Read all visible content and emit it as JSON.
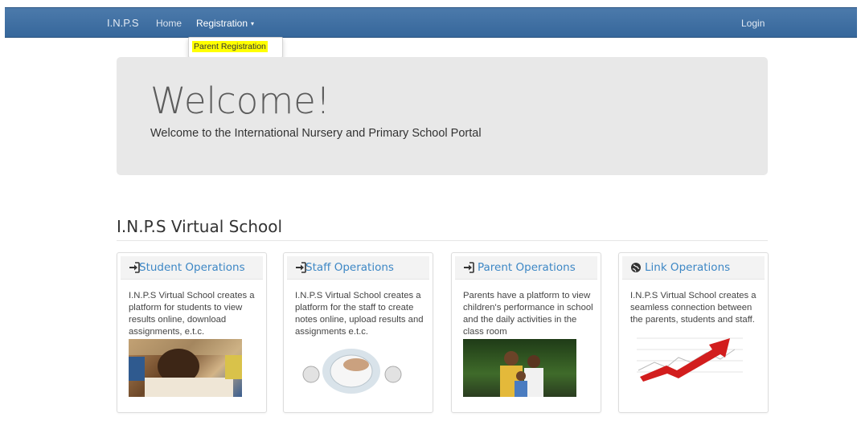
{
  "navbar": {
    "brand": "I.N.P.S",
    "home": "Home",
    "registration": "Registration",
    "caret": "▾",
    "login": "Login",
    "color": "#3f6f9f"
  },
  "dropdown": {
    "items": [
      "Parent Registration"
    ],
    "highlight_color": "#ffff00"
  },
  "jumbotron": {
    "title": "Welcome!",
    "subtitle": "Welcome to the International Nursery and Primary School Portal"
  },
  "section": {
    "title": "I.N.P.S Virtual School"
  },
  "cards": [
    {
      "icon": "sign-in-icon",
      "title": "Student Operations",
      "text": "I.N.P.S Virtual School creates a platform for students to view results online, download assignments, e.t.c.",
      "image": "student-reading-photo"
    },
    {
      "icon": "sign-in-icon",
      "title": "Staff Operations",
      "text": "I.N.P.S Virtual School creates a platform for the staff to create notes online, upload results and assignments e.t.c.",
      "image": "hand-on-mouse-photo"
    },
    {
      "icon": "sign-in-icon",
      "title": "Parent Operations",
      "text": "Parents have a platform to view children's performance in school and the daily activities in the class room",
      "image": "family-photo"
    },
    {
      "icon": "globe-icon",
      "title": "Link Operations",
      "text": "I.N.P.S Virtual School creates a seamless connection between the parents, students and staff.",
      "image": "rising-arrow-chart-photo"
    }
  ],
  "colors": {
    "link": "#3d87c5",
    "jumbotron_bg": "#e8e8e8"
  }
}
